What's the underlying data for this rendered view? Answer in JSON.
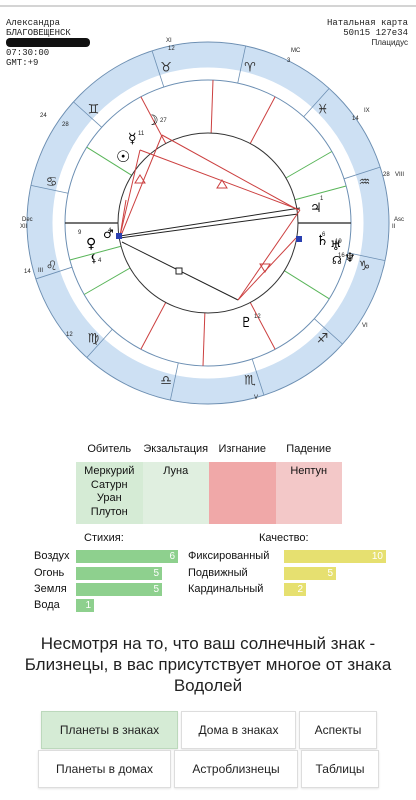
{
  "header": {
    "name": "Александра",
    "city": "БЛАГОВЕЩЕНСК",
    "time": "07:30:00",
    "gmt": "GMT:+9",
    "chart_title": "Натальная карта",
    "coords": "50n15 127e34",
    "house_system": "Плацидус"
  },
  "wheel": {
    "house_numbers": [
      "XI",
      "12",
      "MC",
      "3",
      "IX",
      "14",
      "VIII",
      "28",
      "Dec",
      "XII",
      "24",
      "28",
      "Asc",
      "II",
      "14",
      "III",
      "12",
      "V",
      "VI"
    ],
    "planet_degrees": [
      "27",
      "11",
      "9",
      "4",
      "1",
      "6",
      "19",
      "16",
      "12",
      "18",
      "4"
    ],
    "colors": {
      "ring": "#cde0f3",
      "ring_border": "#6c8fb3",
      "red_line": "#cc4040",
      "green_line": "#59b559",
      "dark_line": "#222"
    }
  },
  "dignity": {
    "headers": [
      "Обитель",
      "Экзальтация",
      "Изгнание",
      "Падение"
    ],
    "domicile": [
      "Меркурий",
      "Сатурн",
      "Уран",
      "Плутон"
    ],
    "exaltation": [
      "Луна"
    ],
    "detriment": [],
    "fall": [
      "Нептун"
    ]
  },
  "elements": {
    "title": "Стихия:",
    "items": [
      {
        "label": "Воздух",
        "value": 6
      },
      {
        "label": "Огонь",
        "value": 5
      },
      {
        "label": "Земля",
        "value": 5
      },
      {
        "label": "Вода",
        "value": 1
      }
    ]
  },
  "quality": {
    "title": "Качество:",
    "items": [
      {
        "label": "Фиксированный",
        "value": 10
      },
      {
        "label": "Подвижный",
        "value": 5
      },
      {
        "label": "Кардинальный",
        "value": 2
      }
    ]
  },
  "message": "Несмотря на то, что ваш солнечный знак - Близнецы, в вас присутствует многое от знака Водолей",
  "tabs": {
    "row1": [
      "Планеты в знаках",
      "Дома в знаках",
      "Аспекты"
    ],
    "row2": [
      "Планеты в домах",
      "Астроблизнецы",
      "Таблицы"
    ]
  }
}
